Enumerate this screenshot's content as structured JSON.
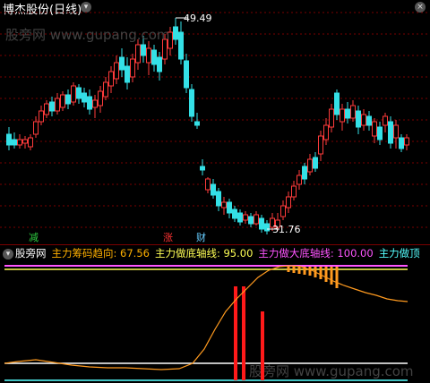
{
  "header": {
    "stock_name": "博杰股份",
    "period": "(日线)"
  },
  "watermark": "股旁网 www.gupang.com",
  "main_chart": {
    "high_label": "49.49",
    "low_label": "31.76",
    "event_tags": [
      {
        "text": "减",
        "color": "#2ecc40"
      },
      {
        "text": "涨",
        "color": "#ff3333"
      },
      {
        "text": "财",
        "color": "#66ccff"
      }
    ],
    "colors": {
      "up": "#ff3b3b",
      "down": "#34e0e6",
      "grid": "#7a0000"
    }
  },
  "indicator": {
    "name": "股旁网",
    "labels": [
      {
        "text": "主力筹码趋向: 67.56",
        "color": "#ffb000"
      },
      {
        "text": "主力做底轴线: 95.00",
        "color": "#ffff55"
      },
      {
        "text": "主力做大底轴线: 100.00",
        "color": "#ff55ff"
      },
      {
        "text": "主力做顶",
        "color": "#55ffff"
      }
    ],
    "line_color": "#ff9a1f"
  }
}
